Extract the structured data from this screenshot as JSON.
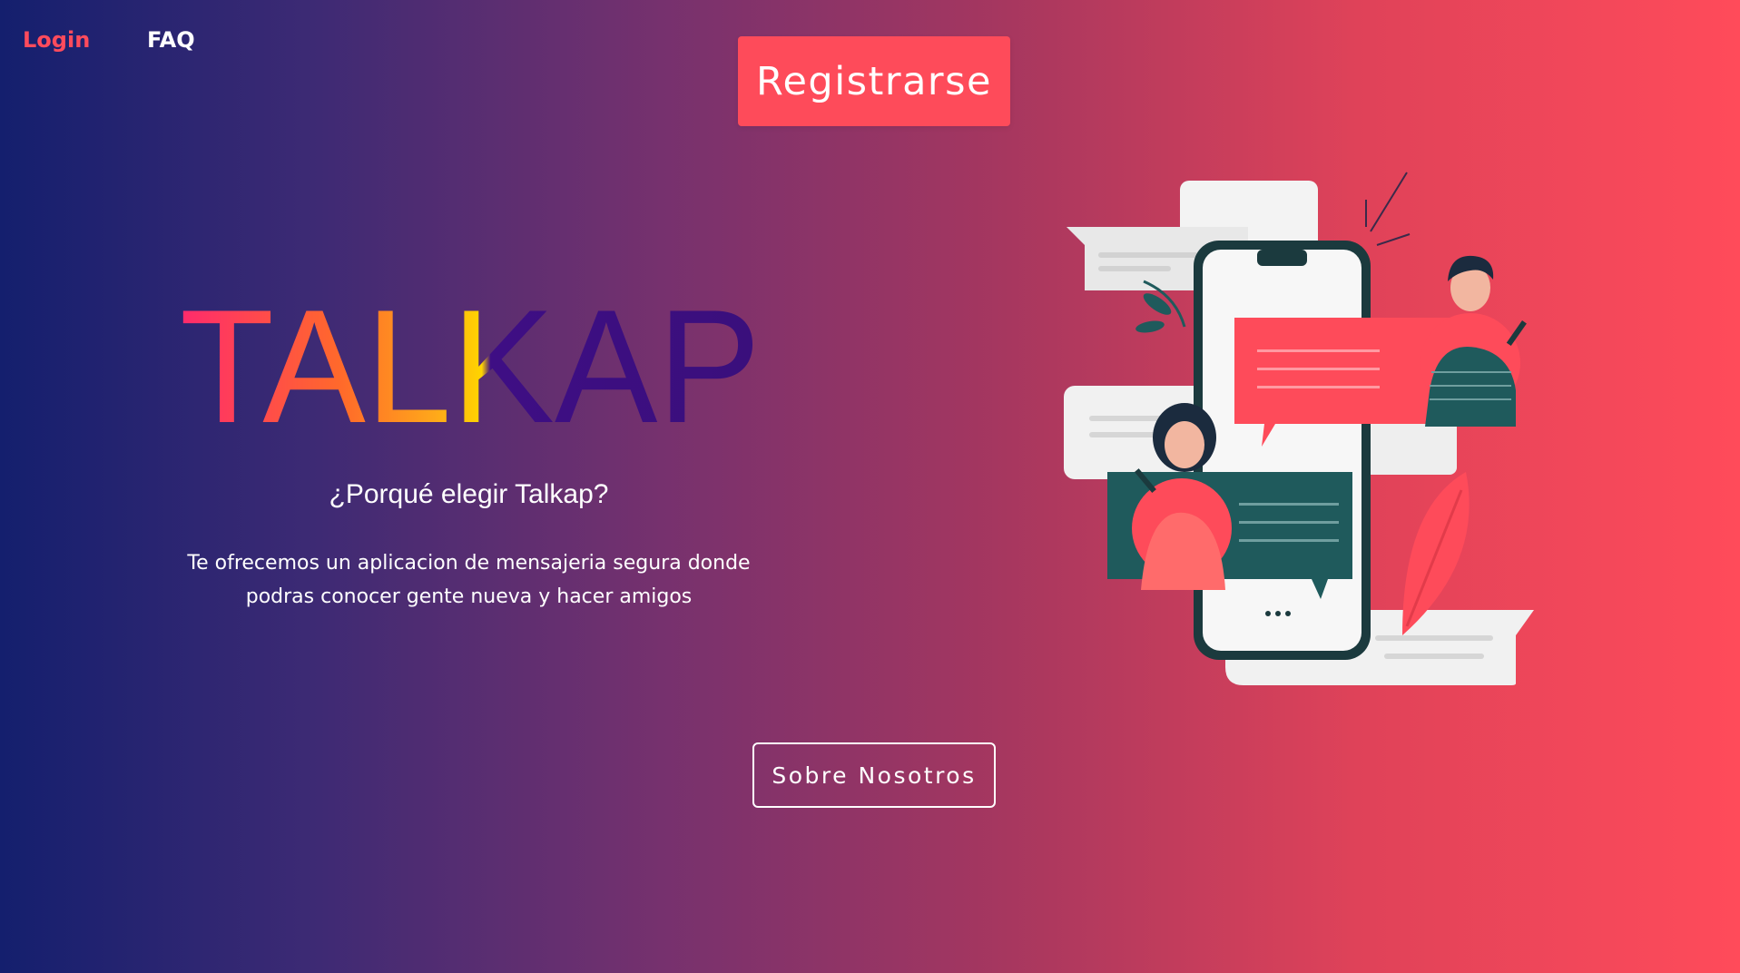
{
  "nav": {
    "login_label": "Login",
    "faq_label": "FAQ"
  },
  "header": {
    "register_label": "Registrarse"
  },
  "hero": {
    "logo_text": "TALKAP",
    "subtitle": "¿Porqué elegir Talkap?",
    "description_line1": "Te ofrecemos un aplicacion de mensajeria segura donde",
    "description_line2": "podras conocer gente nueva y hacer amigos",
    "about_label": "Sobre Nosotros"
  },
  "illustration": {
    "icon": "chat-phone-illustration"
  },
  "colors": {
    "accent": "#fe4b5a",
    "gradient_start": "#141f6e",
    "gradient_end": "#ff4b5a",
    "logo_purple": "#3b0f80"
  }
}
